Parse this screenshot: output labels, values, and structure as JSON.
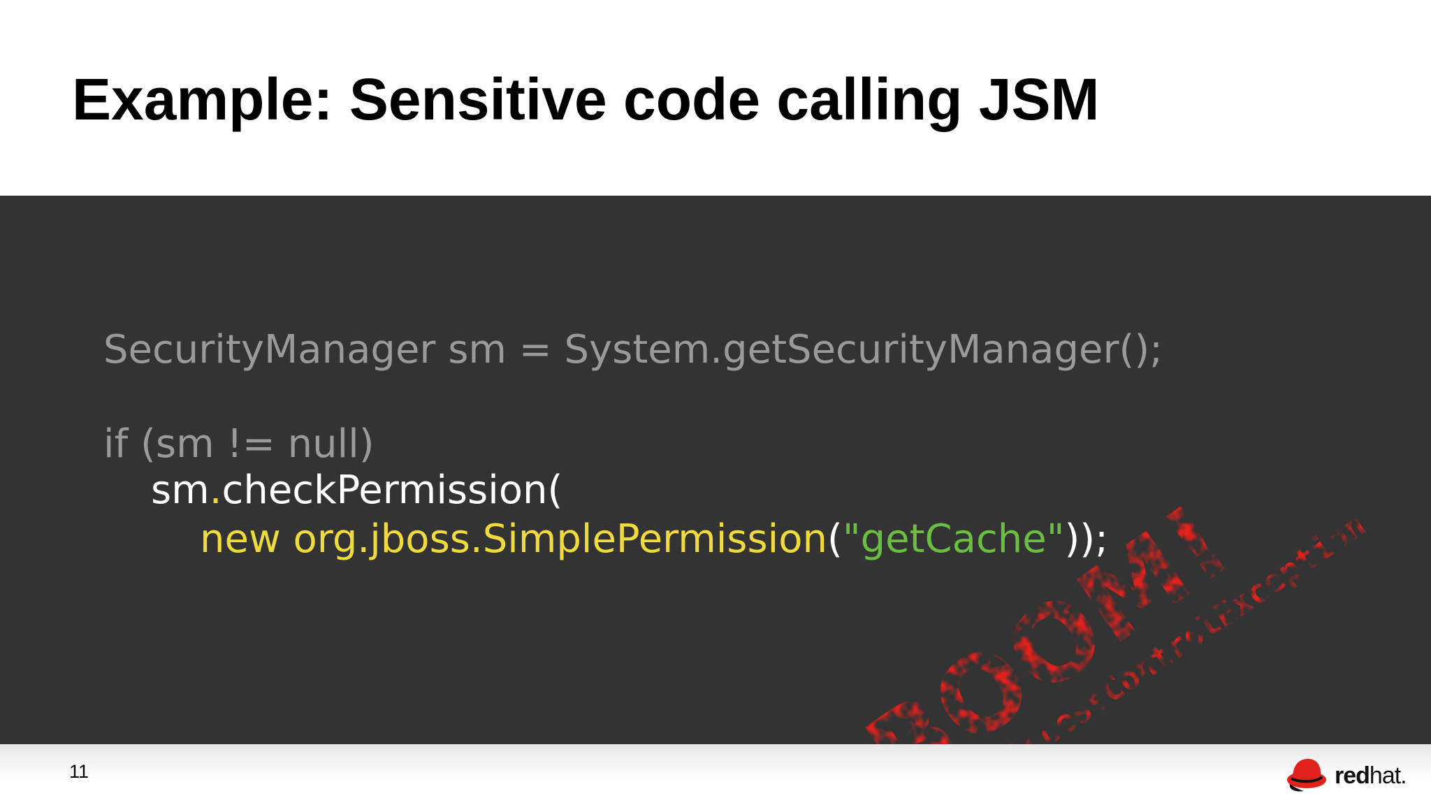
{
  "slide": {
    "title": "Example: Sensitive code calling JSM",
    "page_number": "11"
  },
  "code": {
    "line1": "SecurityManager sm = System.getSecurityManager();",
    "line2": "if (sm != null)",
    "line3_obj": "sm",
    "line3_dot": ".",
    "line3_method": "checkPermission(",
    "line4_new": "new org.jboss.SimplePermission",
    "line4_open": "(",
    "line4_string": "\"getCache\"",
    "line4_close": "));"
  },
  "stamp": {
    "big_text": "BOOM!",
    "small_text": "AccessControlException",
    "color": "#e2201c"
  },
  "logo": {
    "brand_bold": "red",
    "brand_light": "hat.",
    "icon": "red-hat-fedora-icon"
  },
  "colors": {
    "code_background": "#333333",
    "comment_gray": "#9a9a9a",
    "keyword_yellow": "#f0db3e",
    "string_green": "#6abf40",
    "stamp_red": "#e2201c"
  }
}
